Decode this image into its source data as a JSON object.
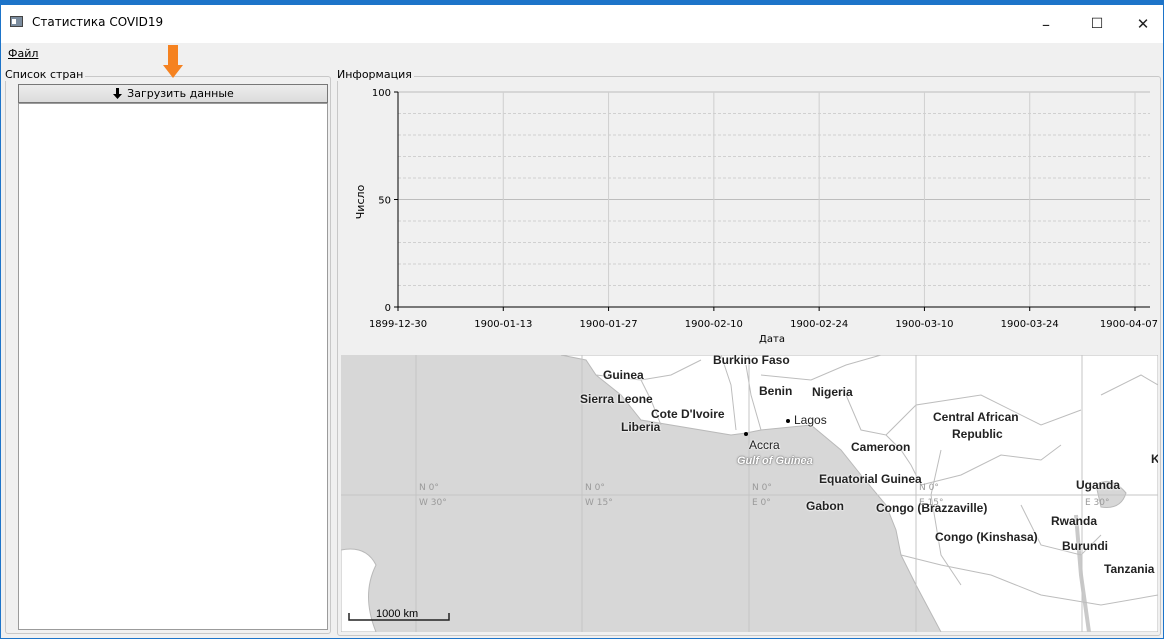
{
  "window": {
    "title": "Статистика COVID19",
    "minimize": "–",
    "maximize": "☐",
    "close": "✕"
  },
  "menu": {
    "file_accel": "Ф",
    "file_rest": "айл"
  },
  "country_list": {
    "title": "Список стран",
    "load_button": "Загрузить данные",
    "load_icon": "arrow-down-icon"
  },
  "info": {
    "title": "Информация"
  },
  "chart_data": {
    "type": "line",
    "series": [],
    "ylabel": "Число",
    "xlabel": "Дата",
    "ylim": [
      0,
      100
    ],
    "yticks": [
      "0",
      "50",
      "100"
    ],
    "xticks": [
      "1899-12-30",
      "1900-01-13",
      "1900-01-27",
      "1900-02-10",
      "1900-02-24",
      "1900-03-10",
      "1900-03-24",
      "1900-04-07"
    ],
    "grid": true
  },
  "map": {
    "countries": [
      "Burkino Faso",
      "Guinea",
      "Benin",
      "Nigeria",
      "Sierra Leone",
      "Cote D'Ivoire",
      "Liberia",
      "Central African",
      "Republic",
      "Cameroon",
      "Equatorial Guinea",
      "Uganda",
      "Gabon",
      "Congo (Brazzaville)",
      "Rwanda",
      "Congo (Kinshasa)",
      "Burundi",
      "Tanzania",
      "K"
    ],
    "cities": [
      "Lagos",
      "Accra"
    ],
    "water": "Gulf of Guinea",
    "grid_labels": [
      "N 0°",
      "W 30°",
      "N 0°",
      "W 15°",
      "N 0°",
      "E 0°",
      "N 0°",
      "E 15°",
      "E 30°"
    ],
    "scale": "1000 km"
  }
}
